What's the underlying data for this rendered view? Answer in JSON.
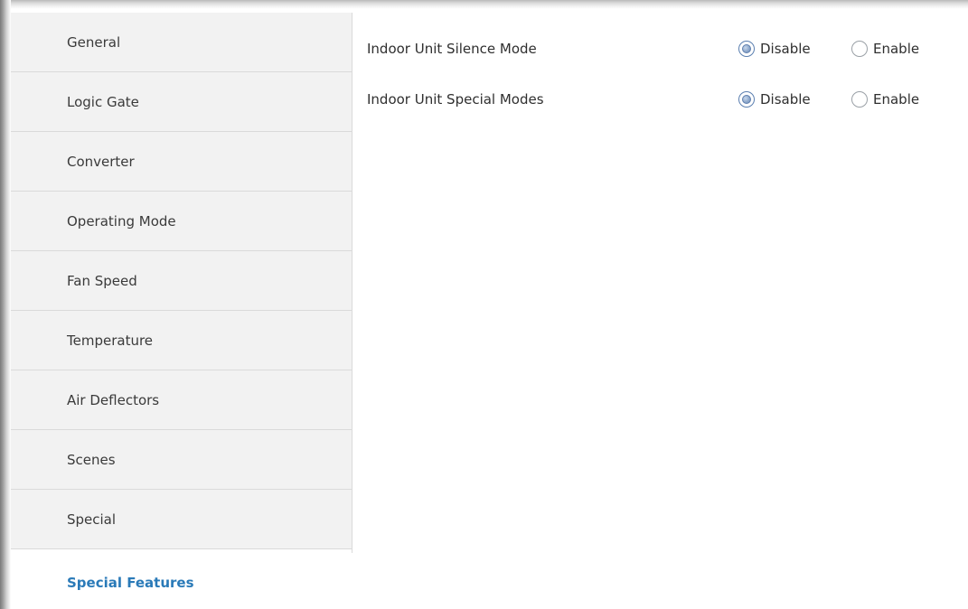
{
  "sidebar": {
    "items": [
      {
        "label": "General"
      },
      {
        "label": "Logic Gate"
      },
      {
        "label": "Converter"
      },
      {
        "label": "Operating Mode"
      },
      {
        "label": "Fan Speed"
      },
      {
        "label": "Temperature"
      },
      {
        "label": "Air Deflectors"
      },
      {
        "label": "Scenes"
      },
      {
        "label": "Special"
      },
      {
        "label": "Special Features"
      }
    ],
    "active": "Special Features"
  },
  "settings": [
    {
      "label": "Indoor Unit Silence Mode",
      "options": [
        "Disable",
        "Enable"
      ],
      "selected": "Disable"
    },
    {
      "label": "Indoor Unit Special Modes",
      "options": [
        "Disable",
        "Enable"
      ],
      "selected": "Disable"
    }
  ],
  "colors": {
    "active_accent": "#2a7ab8",
    "sidebar_bg": "#f2f2f2",
    "divider": "#dadada"
  }
}
